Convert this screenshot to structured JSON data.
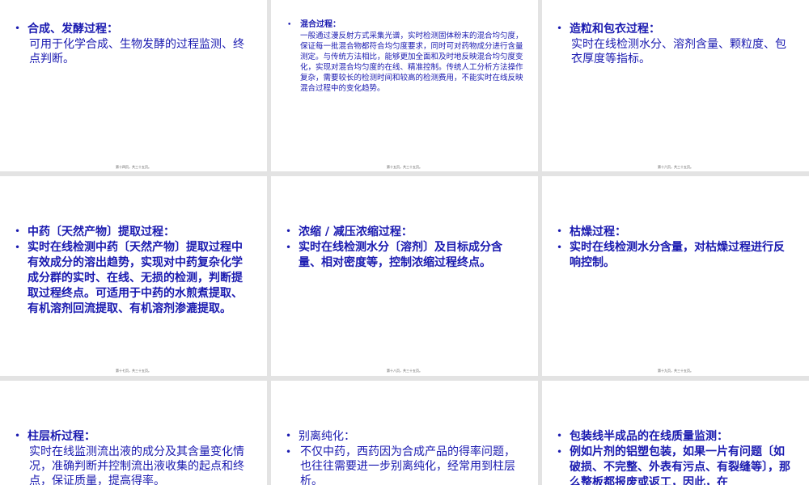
{
  "slides": [
    {
      "title": "合成、发酵过程：",
      "body": "可用于化学合成、生物发酵的过程监测、终点判断。",
      "footer": "第十四页，共三十五页。"
    },
    {
      "title": "混合过程：",
      "body": "一般通过漫反射方式采集光谱，实时检测固体粉末的混合均匀度，保证每一批混合物都符合均匀度要求，同时可对药物成分进行含量测定。与传统方法相比，能够更加全面和及时地反映混合均匀度变化，实现对混合均匀度的在线、精准控制。传统人工分析方法操作复杂，需要较长的检测时间和较高的检测费用，不能实时在线反映混合过程中的变化趋势。",
      "footer": "第十五页，共三十五页。"
    },
    {
      "title": "造粒和包衣过程：",
      "body": "实时在线检测水分、溶剂含量、颗粒度、包衣厚度等指标。",
      "footer": "第十六页，共三十五页。"
    },
    {
      "title": "中药〔天然产物〕提取过程：",
      "body": "实时在线检测中药〔天然产物〕提取过程中有效成分的溶出趋势，实现对中药复杂化学成分群的实时、在线、无损的检测，判断提取过程终点。可适用于中药的水煎煮提取、有机溶剂回流提取、有机溶剂渗漉提取。",
      "footer": "第十七页，共三十五页。"
    },
    {
      "title": "浓缩 / 减压浓缩过程：",
      "body": "实时在线检测水分〔溶剂〕及目标成分含量、相对密度等，控制浓缩过程终点。",
      "footer": "第十八页，共三十五页。"
    },
    {
      "title": "枯燥过程：",
      "body": "实时在线检测水分含量，对枯燥过程进行反响控制。",
      "footer": "第十九页，共三十五页。"
    },
    {
      "title": "柱层析过程：",
      "body": "实时在线监测流出液的成分及其含量变化情况，准确判断并控制流出液收集的起点和终点，保证质量，提高得率。",
      "footer": ""
    },
    {
      "title": "别离纯化：",
      "body": "不仅中药，西药因为合成产品的得率问题，也往往需要进一步别离纯化，经常用到柱层析。",
      "footer": ""
    },
    {
      "title": "包装线半成品的在线质量监测：",
      "body": "例如片剂的铝塑包装，如果一片有问题〔如破损、不完整、外表有污点、有裂缝等〕，那么整板都报废或返工，因此，在",
      "footer": ""
    }
  ]
}
